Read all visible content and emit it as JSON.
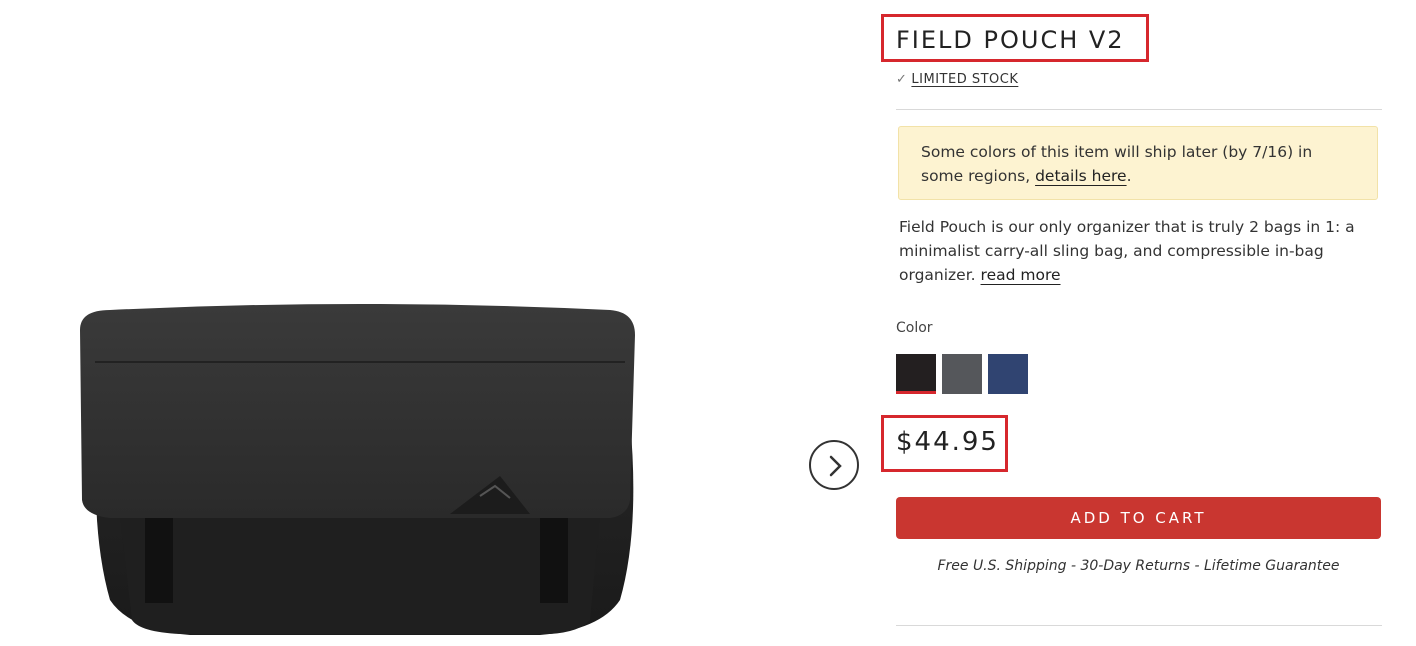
{
  "product": {
    "title": "FIELD POUCH V2",
    "stock_status": "LIMITED STOCK",
    "image_label": "Field Pouch V2 black pouch product photo"
  },
  "notice": {
    "text_before": "Some colors of this item will ship later (by 7/16) in some regions, ",
    "link": "details here",
    "text_after": "."
  },
  "description": {
    "text": "Field Pouch is our only organizer that is truly 2 bags in 1: a minimalist carry-all sling bag, and compressible in-bag organizer. ",
    "read_more": "read more"
  },
  "color": {
    "label": "Color",
    "swatches": [
      {
        "hex": "#231f20",
        "selected": true
      },
      {
        "hex": "#55575b",
        "selected": false
      },
      {
        "hex": "#304471",
        "selected": false
      }
    ]
  },
  "price": "$44.95",
  "cart": {
    "button_label": "ADD TO CART"
  },
  "shipping_note": "Free U.S. Shipping - 30-Day Returns - Lifetime Guarantee",
  "icons": {
    "stock": "check-icon",
    "carousel_next": "chevron-right-icon"
  },
  "colors": {
    "accent": "#d6272d",
    "cart_button": "#c93630",
    "notice_bg": "#fdf3d1"
  }
}
